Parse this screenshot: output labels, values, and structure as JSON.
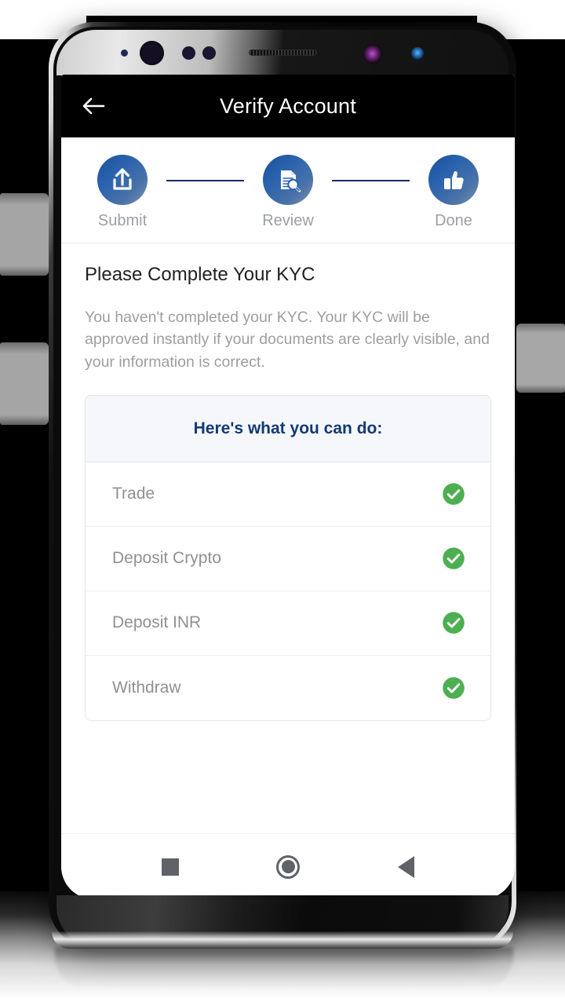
{
  "appbar": {
    "title": "Verify Account",
    "back_icon": "arrow-left-icon"
  },
  "stepper": {
    "steps": [
      {
        "label": "Submit",
        "icon": "upload-icon"
      },
      {
        "label": "Review",
        "icon": "document-search-icon"
      },
      {
        "label": "Done",
        "icon": "thumbs-up-icon"
      }
    ]
  },
  "content": {
    "title": "Please Complete Your KYC",
    "description": "You haven't completed your KYC. Your KYC will be approved instantly if your documents are clearly visible, and your information is correct.",
    "card": {
      "header": "Here's what you can do:",
      "rows": [
        {
          "label": "Trade",
          "status_icon": "green-check-icon"
        },
        {
          "label": "Deposit Crypto",
          "status_icon": "green-check-icon"
        },
        {
          "label": "Deposit INR",
          "status_icon": "green-check-icon"
        },
        {
          "label": "Withdraw",
          "status_icon": "green-check-icon"
        }
      ]
    }
  },
  "navbar": {
    "recents_icon": "square-icon",
    "home_icon": "circle-icon",
    "back_icon": "triangle-back-icon"
  },
  "colors": {
    "accent_blue": "#1b4f9c",
    "card_header_text": "#123a75",
    "success_green": "#4caf50",
    "muted_text": "#9e9e9e",
    "appbar_bg": "#000000"
  }
}
